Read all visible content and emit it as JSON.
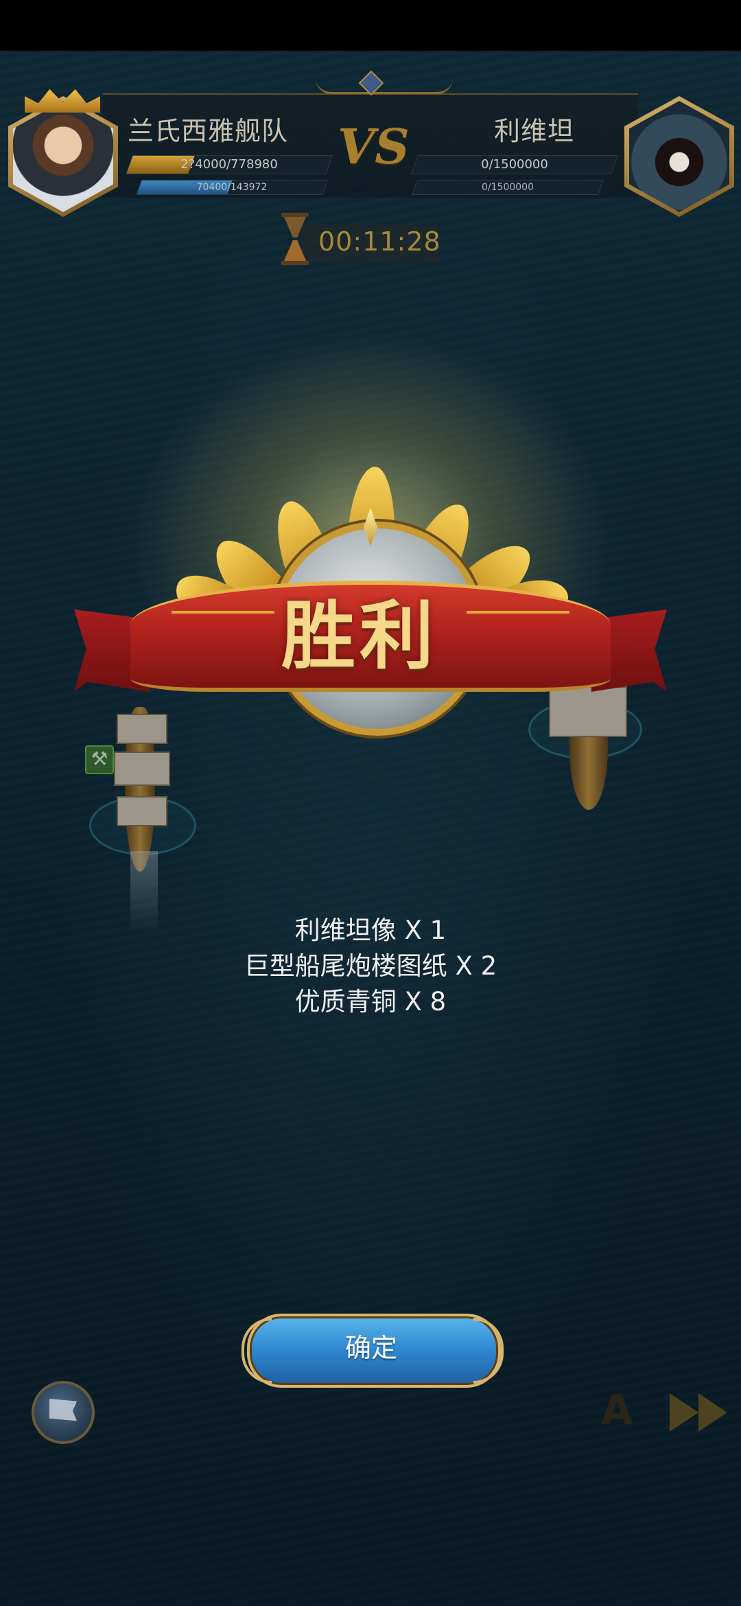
{
  "header": {
    "left_team_name": "兰氏西雅舰队",
    "right_team_name": "利维坦",
    "vs_label": "VS",
    "left_hp_text": "2?4000/778980",
    "left_hp_fraction": 0.31,
    "left_mp_text": "70400/143972",
    "left_mp_fraction": 0.49,
    "right_hp_text": "0/1500000",
    "right_hp_fraction": 0.0,
    "right_mp_text": "0/1500000",
    "right_mp_fraction": 0.0,
    "timer": "00:11:28"
  },
  "victory": {
    "title": "胜利"
  },
  "rewards": [
    "利维坦像 X 1",
    "巨型船尾炮楼图纸 X 2",
    "优质青铜 X 8"
  ],
  "buttons": {
    "confirm": "确定",
    "auto": "A"
  },
  "colors": {
    "sea": "#123243",
    "gold": "#d4a236",
    "ribbon_red": "#b0221c",
    "confirm_blue": "#2f86cf"
  },
  "icons": {
    "timer": "hourglass-icon",
    "speed": "fast-forward-icon",
    "flag": "surrender-flag-icon",
    "repair": "repair-tools-icon"
  }
}
